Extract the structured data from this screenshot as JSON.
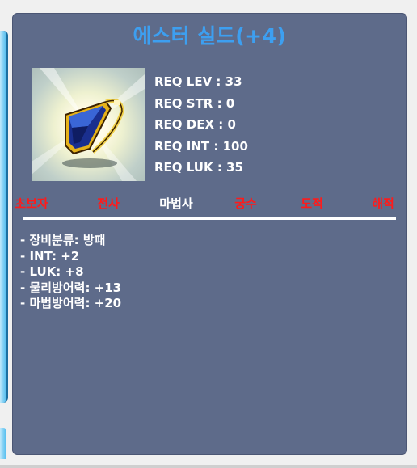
{
  "item": {
    "name": "에스터 실드(+4)",
    "icon": "shield-icon"
  },
  "requirements": [
    "REQ LEV : 33",
    "REQ STR : 0",
    "REQ DEX : 0",
    "REQ INT : 100",
    "REQ LUK : 35"
  ],
  "jobs": [
    {
      "label": "초보자",
      "allowed": false
    },
    {
      "label": "전사",
      "allowed": false
    },
    {
      "label": "마법사",
      "allowed": true
    },
    {
      "label": "궁수",
      "allowed": false
    },
    {
      "label": "도적",
      "allowed": false
    },
    {
      "label": "해적",
      "allowed": false
    }
  ],
  "stats": [
    "- 장비분류: 방패",
    "- INT: +2",
    "- LUK: +8",
    "- 물리방어력: +13",
    "- 마법방어력: +20"
  ],
  "colors": {
    "tooltip_bg": "#5e6b8a",
    "title": "#3d9ff0",
    "job_not_allowed": "#ff1a1a",
    "job_allowed": "#ffffff"
  }
}
